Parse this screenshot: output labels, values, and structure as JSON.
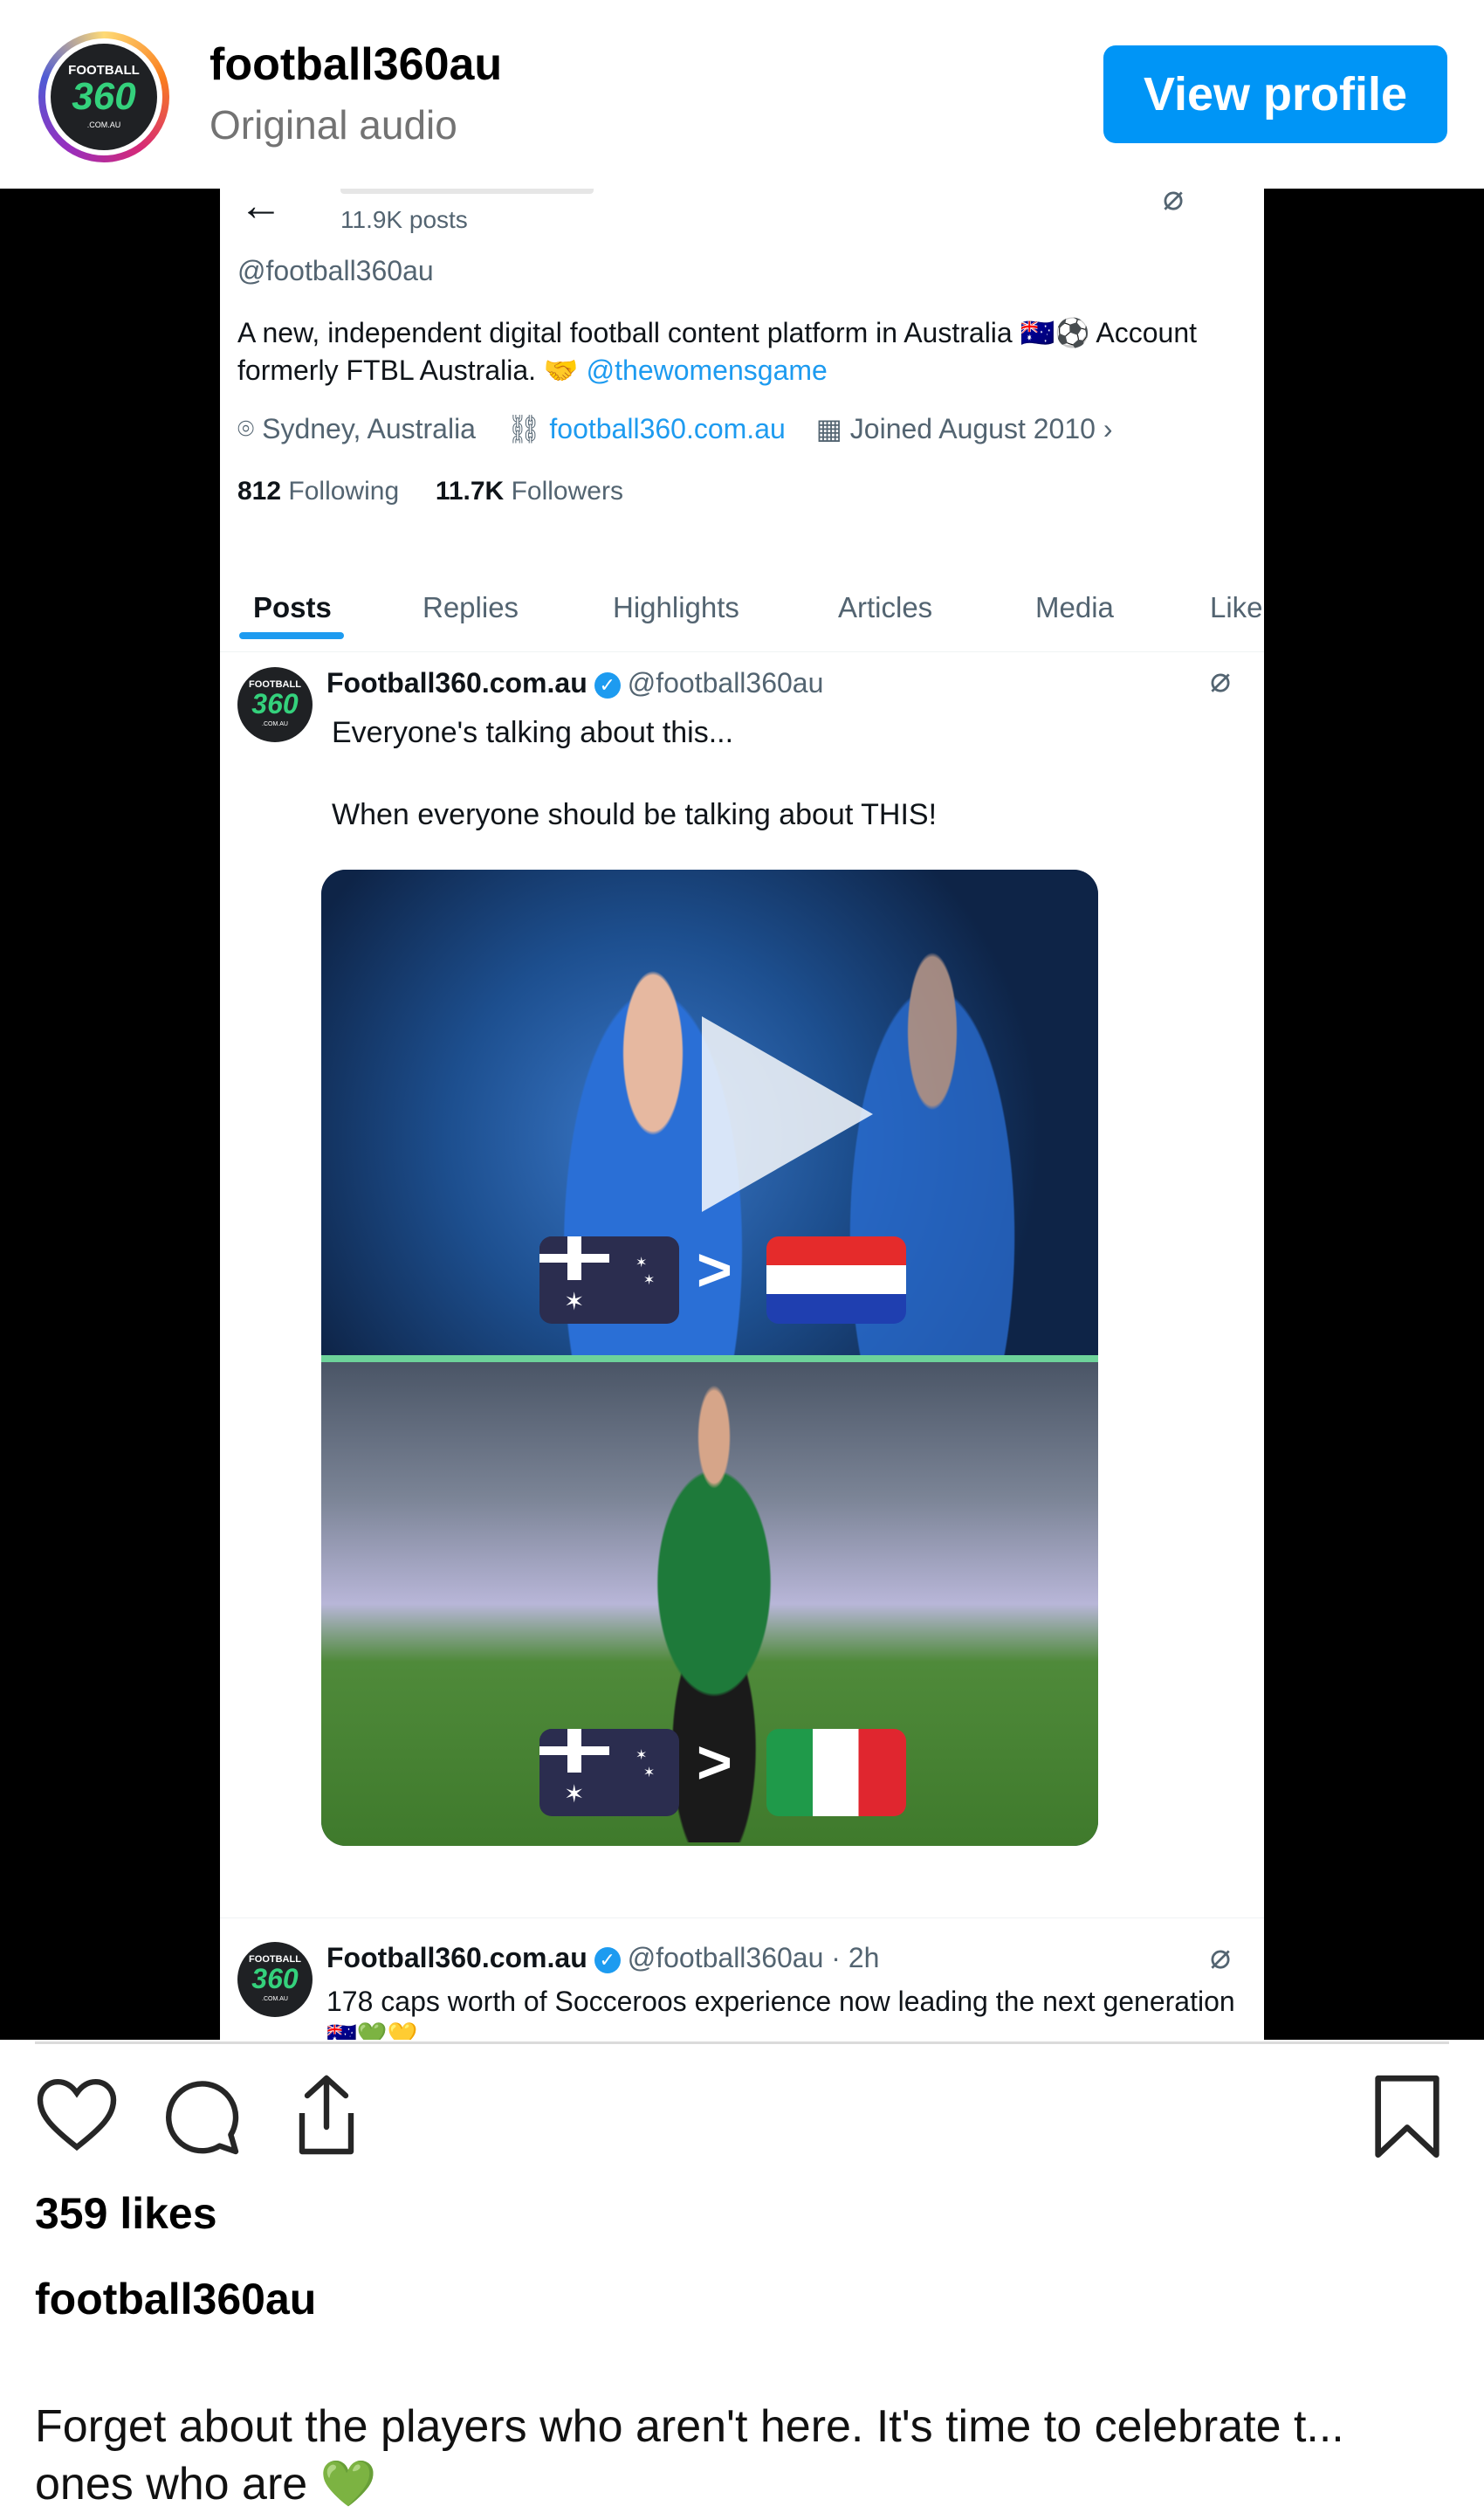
{
  "ig_header": {
    "username": "football360au",
    "audio": "Original audio",
    "view_profile_label": "View profile",
    "logo": {
      "top": "FOOTBALL",
      "num": "360",
      "sub": ".COM.AU"
    }
  },
  "twitter_profile": {
    "post_count": "11.9K posts",
    "handle": "@football360au",
    "bio_text": "A new, independent digital football content platform in Australia 🇦🇺⚽ Account formerly FTBL Australia. 🤝",
    "bio_link": "@thewomensgame",
    "location": "Sydney, Australia",
    "website": "football360.com.au",
    "joined": "Joined August 2010",
    "following_count": "812",
    "following_label": "Following",
    "followers_count": "11.7K",
    "followers_label": "Followers",
    "tabs": [
      "Posts",
      "Replies",
      "Highlights",
      "Articles",
      "Media",
      "Like"
    ]
  },
  "tweet1": {
    "name": "Football360.com.au",
    "handle": "@football360au",
    "line1": "Everyone's talking about this...",
    "line2": "When everyone should be talking about THIS!",
    "gt_top": ">",
    "gt_bottom": ">"
  },
  "tweet2": {
    "name": "Football360.com.au",
    "handle": "@football360au · 2h",
    "text": "178 caps worth of Socceroos experience now leading the next generation",
    "emojis": "🇦🇺💚💛"
  },
  "ig_footer": {
    "likes": "359 likes",
    "caption_user": "football360au",
    "caption_text": "Forget about the players who aren't here. It's time to celebrate t... ones who are 💚"
  },
  "colors": {
    "instagram_blue": "#0095f6",
    "twitter_blue": "#1d9bf0",
    "logo_green": "#34d17c"
  }
}
